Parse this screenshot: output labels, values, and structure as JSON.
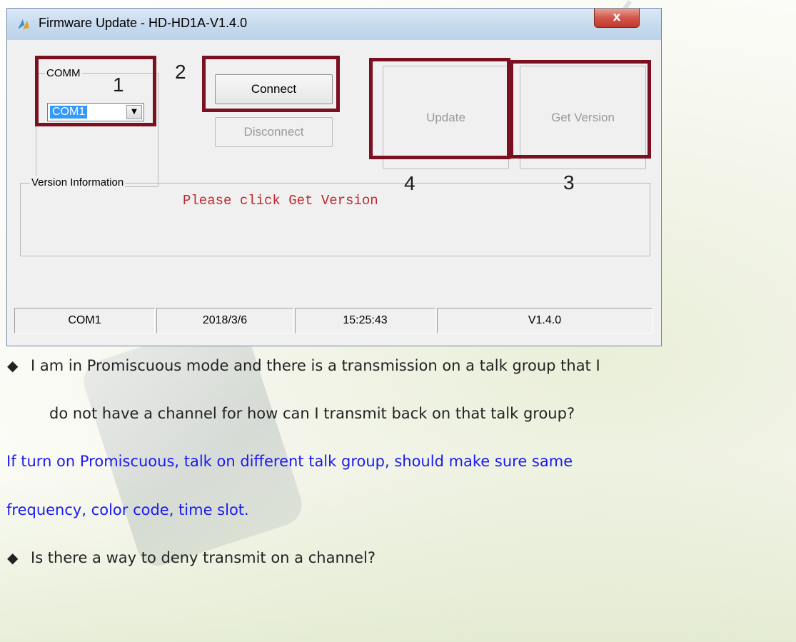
{
  "window": {
    "title": "Firmware Update - HD-HD1A-V1.4.0",
    "close_label": "x"
  },
  "comm_group": {
    "title": "COMM",
    "selected_port": "COM1"
  },
  "buttons": {
    "connect": "Connect",
    "disconnect": "Disconnect",
    "update": "Update",
    "get_version": "Get Version"
  },
  "version_group": {
    "title": "Version Information",
    "message": "Please click  Get Version"
  },
  "annotations": [
    "1",
    "2",
    "3",
    "4"
  ],
  "status_bar": {
    "port": "COM1",
    "date": "2018/3/6",
    "time": "15:25:43",
    "version": "V1.4.0"
  },
  "document": {
    "question1_line1": "I am in Promiscuous mode and there is a transmission on a talk group that I",
    "question1_line2": "do not have a channel for how can I transmit back on that talk group?",
    "answer1_line1": "If turn on Promiscuous, talk on different talk group, should make sure same",
    "answer1_line2": "frequency, color code, time slot.",
    "question2": "Is there a way to deny transmit on a channel?",
    "bullet": "◆"
  },
  "colors": {
    "annotation_box": "#7a1020",
    "version_message": "#c0282d",
    "answer_text": "#1a1af0"
  }
}
